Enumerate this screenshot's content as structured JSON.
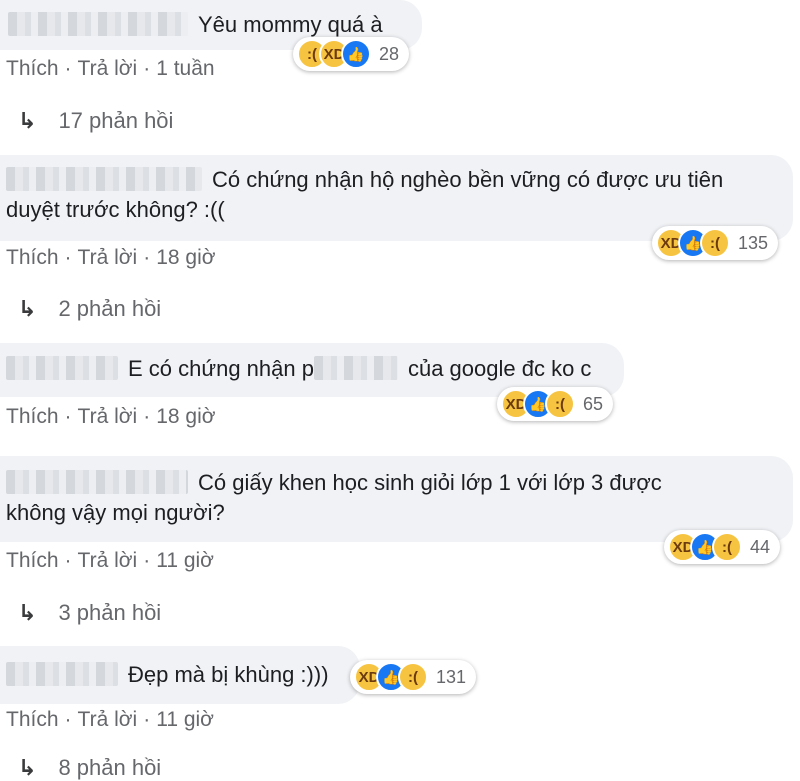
{
  "comments": [
    {
      "text": "Yêu mommy quá à",
      "actions": {
        "like": "Thích",
        "reply": "Trả lời",
        "time": "1 tuần"
      },
      "reactions": {
        "icons": [
          "sad-icon",
          "haha-icon",
          "like-icon"
        ],
        "count": "28"
      },
      "replies": "17 phản hồi"
    },
    {
      "line1": "Có chứng nhận hộ nghèo bền vững có được ưu tiên",
      "line2": "duyệt trước không? :((",
      "actions": {
        "like": "Thích",
        "reply": "Trả lời",
        "time": "18 giờ"
      },
      "reactions": {
        "icons": [
          "haha-icon",
          "like-icon",
          "sad-icon"
        ],
        "count": "135"
      },
      "replies": "2 phản hồi"
    },
    {
      "text_before": "E có chứng nhận p",
      "text_after": "của google đc ko c",
      "actions": {
        "like": "Thích",
        "reply": "Trả lời",
        "time": "18 giờ"
      },
      "reactions": {
        "icons": [
          "haha-icon",
          "like-icon",
          "sad-icon"
        ],
        "count": "65"
      }
    },
    {
      "line1": "Có giấy khen học sinh giỏi lớp 1 với lớp 3 được",
      "line2": "không vậy mọi người?",
      "actions": {
        "like": "Thích",
        "reply": "Trả lời",
        "time": "11 giờ"
      },
      "reactions": {
        "icons": [
          "haha-icon",
          "like-icon",
          "sad-icon"
        ],
        "count": "44"
      },
      "replies": "3 phản hồi"
    },
    {
      "text": "Đẹp mà bị khùng :)))",
      "actions": {
        "like": "Thích",
        "reply": "Trả lời",
        "time": "11 giờ"
      },
      "reactions": {
        "icons": [
          "haha-icon",
          "like-icon",
          "sad-icon"
        ],
        "count": "131"
      },
      "replies": "8 phản hồi"
    }
  ],
  "glyphs": {
    "arrow": "↳",
    "dot": "·",
    "sad": ":(",
    "haha": "XD",
    "like": "👍"
  },
  "colors": {
    "bubble": "#f0f2f5",
    "meta_text": "#65676b",
    "like_blue": "#1877f2",
    "emoji_yellow": "#f7c441"
  }
}
